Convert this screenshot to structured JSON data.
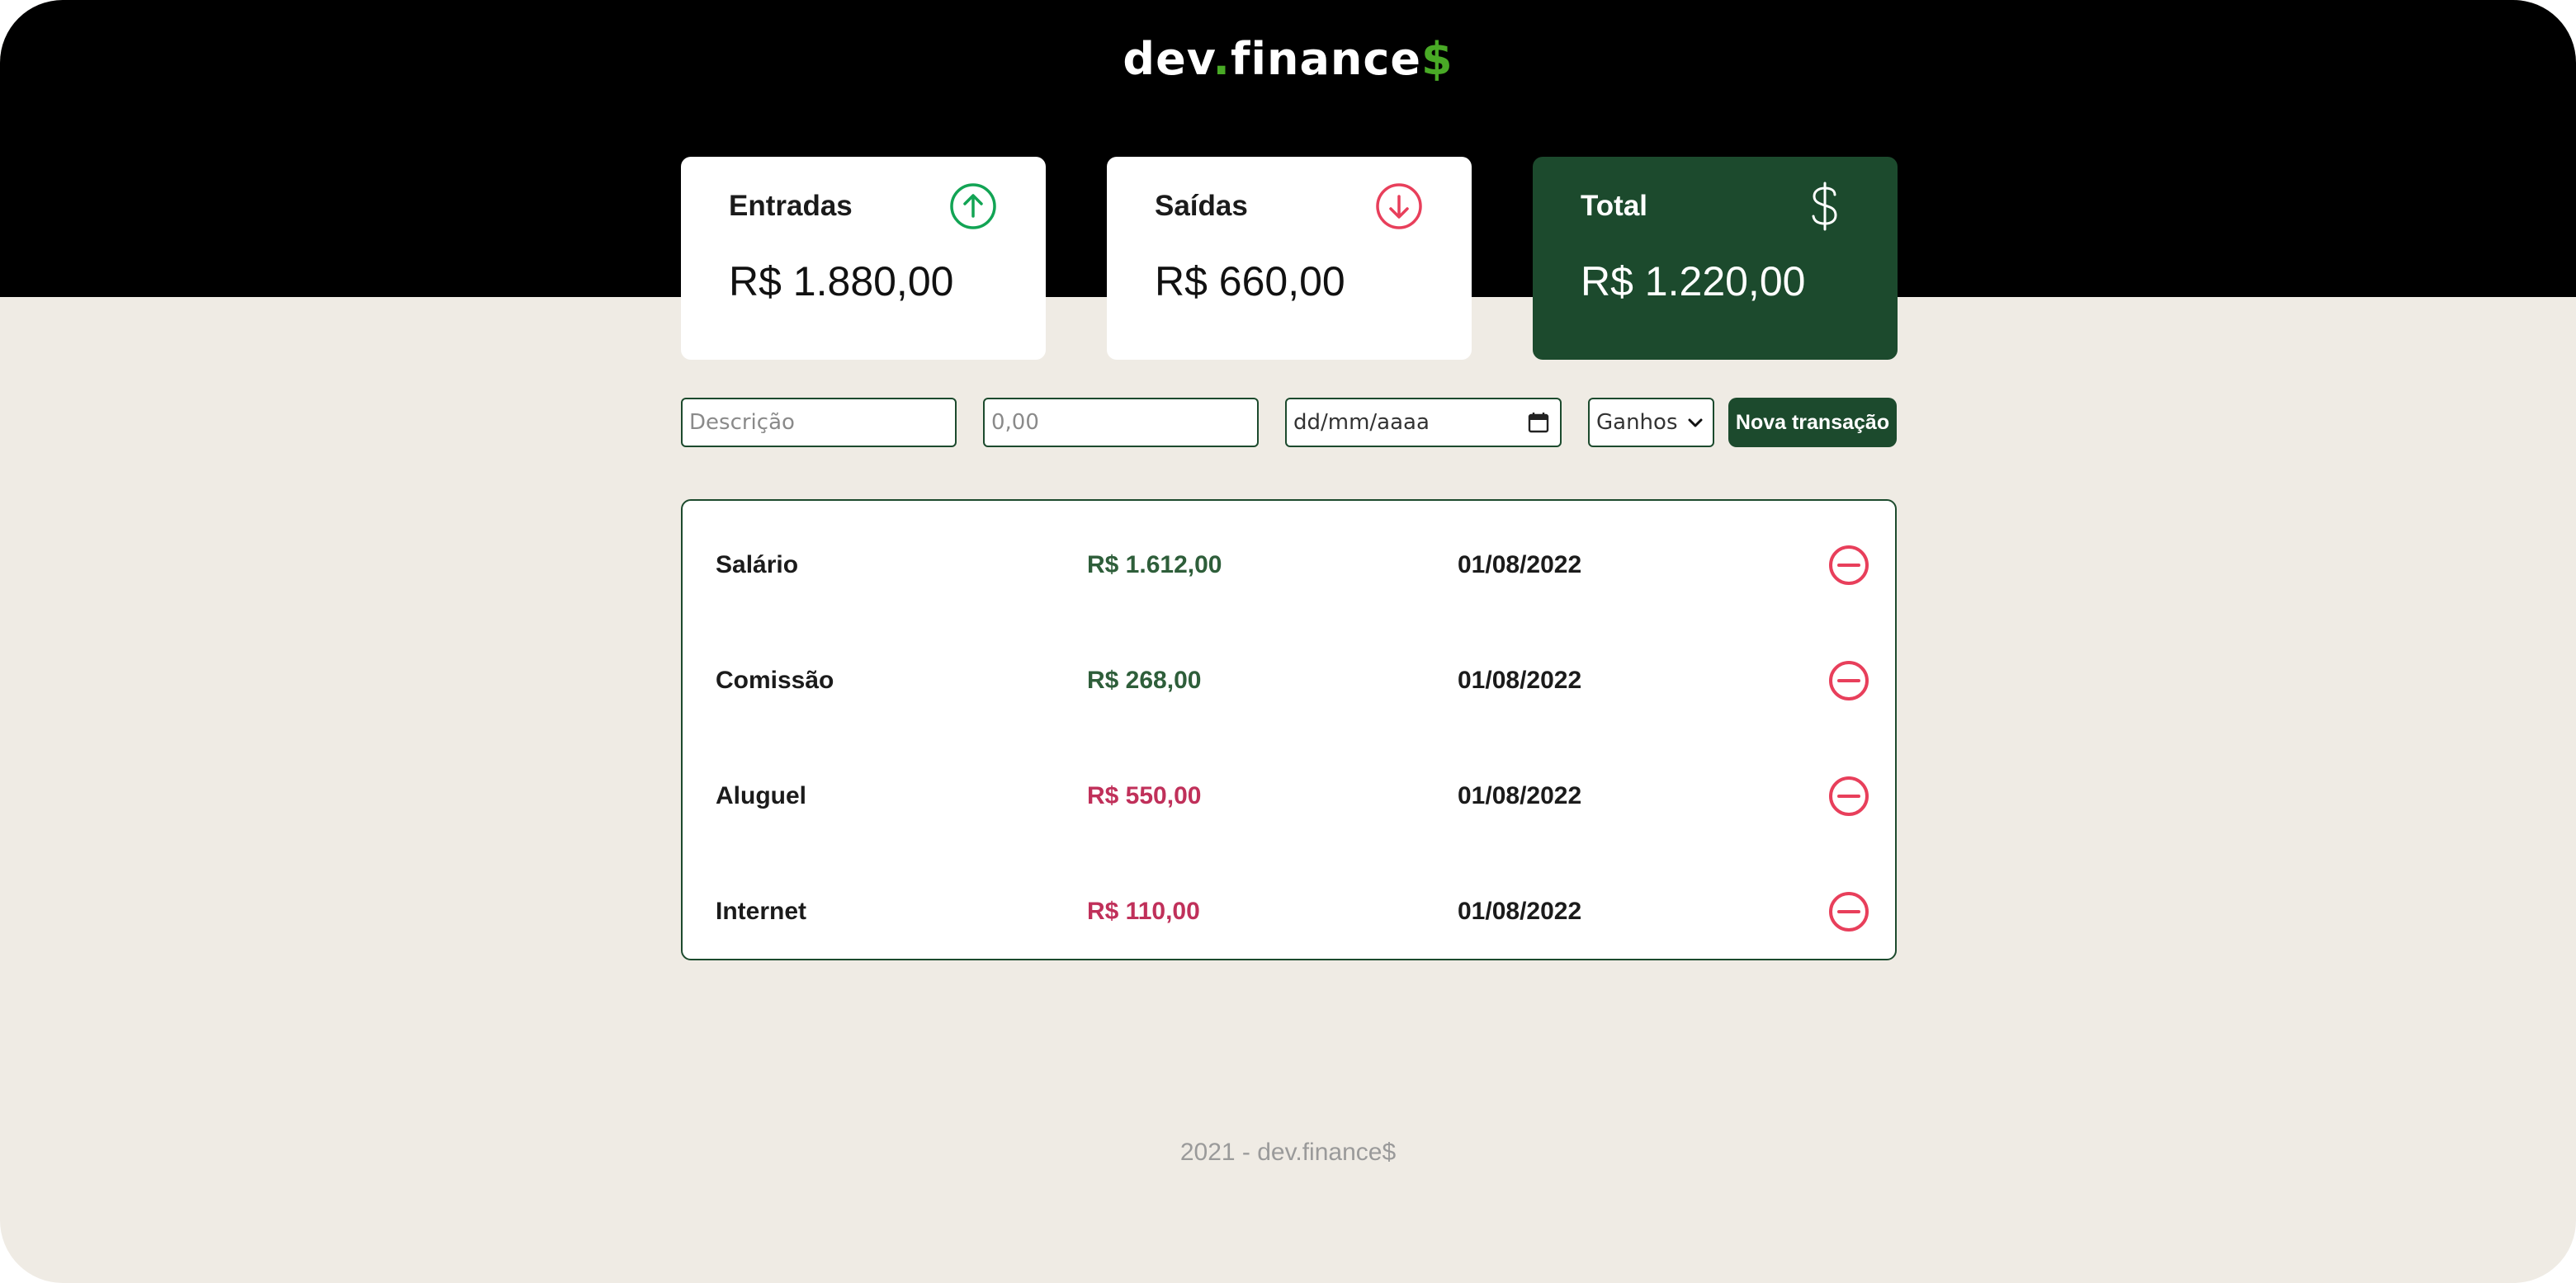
{
  "header": {
    "logo_dev": "dev",
    "logo_dot": ".",
    "logo_finance": "finance",
    "logo_dollar": "$"
  },
  "summary": {
    "income": {
      "label": "Entradas",
      "value": "R$ 1.880,00",
      "icon": "arrow-up-circle-icon",
      "color": "#12A454"
    },
    "expense": {
      "label": "Saídas",
      "value": "R$ 660,00",
      "icon": "arrow-down-circle-icon",
      "color": "#E83F5B"
    },
    "total": {
      "label": "Total",
      "value": "R$ 1.220,00",
      "icon": "dollar-sign-icon",
      "color": "#1C4A2D"
    }
  },
  "form": {
    "description_placeholder": "Descrição",
    "amount_placeholder": "0,00",
    "date_placeholder": "dd/mm/aaaa",
    "type_selected": "Ganhos",
    "submit_label": "Nova transação"
  },
  "transactions": [
    {
      "description": "Salário",
      "amount": "R$ 1.612,00",
      "type": "income",
      "date": "01/08/2022"
    },
    {
      "description": "Comissão",
      "amount": "R$ 268,00",
      "type": "income",
      "date": "01/08/2022"
    },
    {
      "description": "Aluguel",
      "amount": "R$ 550,00",
      "type": "expense",
      "date": "01/08/2022"
    },
    {
      "description": "Internet",
      "amount": "R$ 110,00",
      "type": "expense",
      "date": "01/08/2022"
    }
  ],
  "footer": {
    "text": "2021 - dev.finance$"
  },
  "colors": {
    "header_bg": "#000000",
    "page_bg": "#EFEBE4",
    "brand_green": "#1C4A2D",
    "accent_green": "#49AA26",
    "income_text": "#2E5E3A",
    "expense_text": "#C0305A",
    "remove_red": "#E83F5B"
  }
}
